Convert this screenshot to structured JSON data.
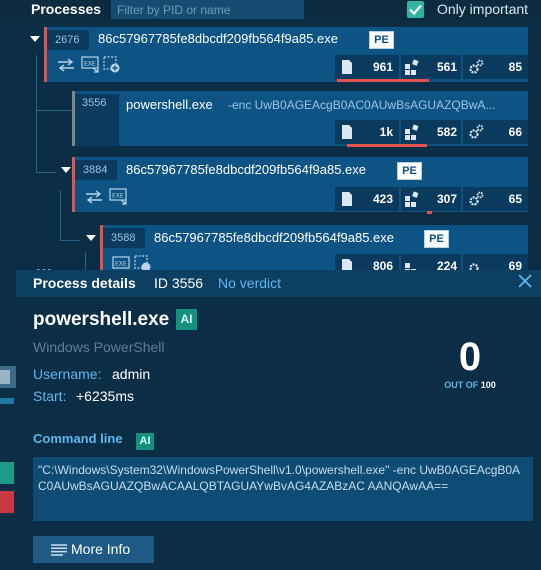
{
  "header": {
    "title": "Processes",
    "filter_placeholder": "Filter by PID or name",
    "only_important_label": "Only important",
    "only_important_checked": true
  },
  "processes": [
    {
      "pid": "2676",
      "name": "86c57967785fe8dbcdf209fb564f9a85.exe",
      "badge": "PE",
      "files": "961",
      "registry": "561",
      "modules": "85",
      "indicator": "red",
      "icons": [
        "network-icon",
        "exe-icon",
        "add-module-icon"
      ]
    },
    {
      "pid": "3556",
      "name": "powershell.exe",
      "cmd": "-enc UwB0AGEAcgB0AC0AUwBsAGUAZQBwA...",
      "files": "1k",
      "registry": "582",
      "modules": "66",
      "indicator": "gray"
    },
    {
      "pid": "3884",
      "name": "86c57967785fe8dbcdf209fb564f9a85.exe",
      "badge": "PE",
      "files": "423",
      "registry": "307",
      "modules": "65",
      "indicator": "red",
      "icons": [
        "network-icon",
        "exe-icon"
      ]
    },
    {
      "pid": "3588",
      "name": "86c57967785fe8dbcdf209fb564f9a85.exe",
      "badge": "PE",
      "files": "806",
      "registry": "224",
      "modules": "69",
      "indicator": "red",
      "icons": [
        "exe-icon",
        "add-module-icon"
      ]
    }
  ],
  "details": {
    "title": "Process details",
    "id_text": "ID 3556",
    "verdict": "No verdict",
    "name": "powershell.exe",
    "ai_badge": "AI",
    "description": "Windows PowerShell",
    "username_label": "Username:",
    "username": "admin",
    "start_label": "Start:",
    "start": "+6235ms",
    "score": "0",
    "score_out_of_label": "OUT OF",
    "score_max": "100",
    "command_line_label": "Command line",
    "command_line": "\"C:\\Windows\\System32\\WindowsPowerShell\\v1.0\\powershell.exe\" -enc UwB0AGEAcgB0AC0AUwBsAGUAZQBwACAALQBTAGUAYwBvAG4AZABzAC AANQAwAA==",
    "more_info_label": "More Info"
  },
  "tree_dots": "•••"
}
